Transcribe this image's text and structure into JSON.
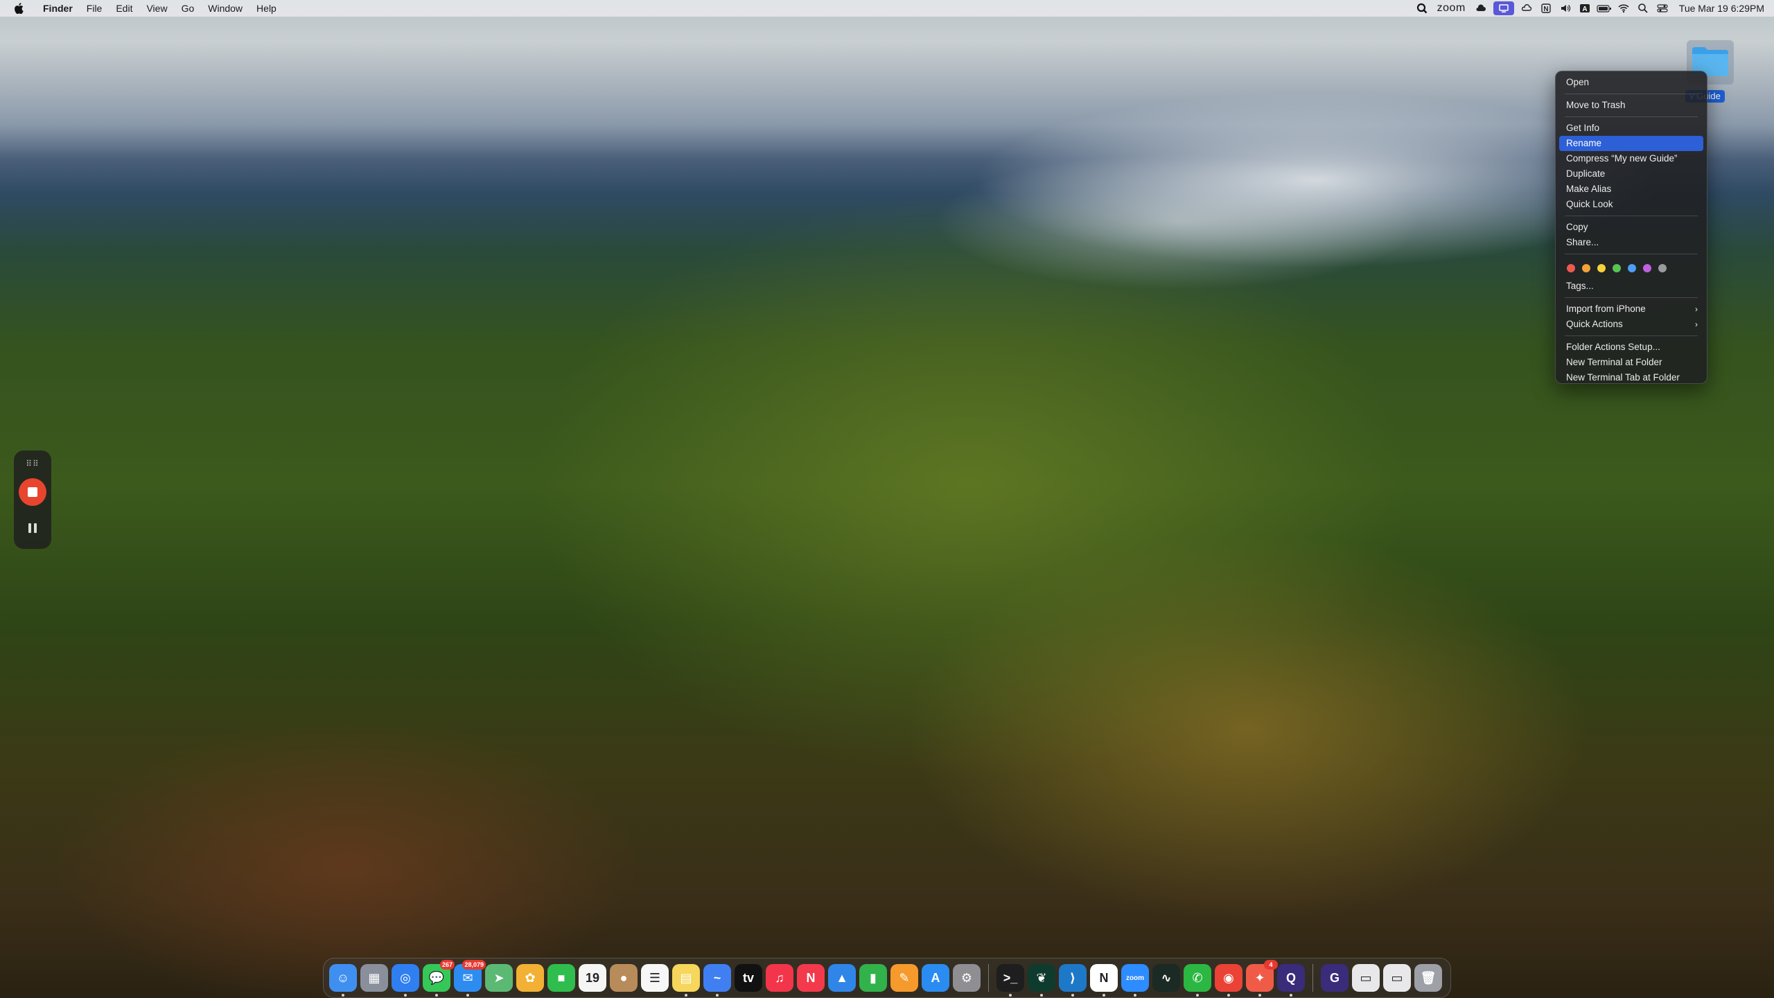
{
  "menubar": {
    "app_name": "Finder",
    "menus": [
      "File",
      "Edit",
      "View",
      "Go",
      "Window",
      "Help"
    ],
    "status_icons": [
      "search-app-icon",
      "zoom-text",
      "weather-icon",
      "screen-share-icon",
      "cloud-icon",
      "notion-icon",
      "volume-icon",
      "input-source-icon",
      "battery-icon",
      "wifi-icon",
      "spotlight-icon",
      "control-center-icon"
    ],
    "zoom_label": "zoom",
    "input_source_label": "A",
    "notion_label": "N",
    "clock": "Tue Mar 19  6:29PM"
  },
  "desktop": {
    "folder_label": "v Guide"
  },
  "context_menu": {
    "open": "Open",
    "move_to_trash": "Move to Trash",
    "get_info": "Get Info",
    "rename": "Rename",
    "compress": "Compress “My new Guide”",
    "duplicate": "Duplicate",
    "make_alias": "Make Alias",
    "quick_look": "Quick Look",
    "copy": "Copy",
    "share": "Share...",
    "tag_colors": [
      "#ec5a4f",
      "#f3a23a",
      "#f5d33a",
      "#58c453",
      "#4d9ef5",
      "#c060e0",
      "#9a9a9e"
    ],
    "tags": "Tags...",
    "import_from_iphone": "Import from iPhone",
    "quick_actions": "Quick Actions",
    "folder_actions_setup": "Folder Actions Setup...",
    "new_terminal_at_folder": "New Terminal at Folder",
    "new_terminal_tab_at_folder": "New Terminal Tab at Folder",
    "submenu_arrow": "›"
  },
  "recording_widget": {
    "grip": "⠿⠿"
  },
  "dock": {
    "apps": [
      {
        "name": "finder",
        "glyph": "☺",
        "color": "#3f8ff0",
        "running": true
      },
      {
        "name": "launchpad",
        "glyph": "▦",
        "color": "#8a8f9c",
        "running": false
      },
      {
        "name": "safari",
        "glyph": "◎",
        "color": "#2f7ff0",
        "running": true
      },
      {
        "name": "messages",
        "glyph": "💬",
        "color": "#36c759",
        "badge": "267",
        "running": true
      },
      {
        "name": "mail",
        "glyph": "✉",
        "color": "#2d8cf0",
        "badge": "28,079",
        "running": true
      },
      {
        "name": "maps",
        "glyph": "➤",
        "color": "#5bb974",
        "running": false
      },
      {
        "name": "photos",
        "glyph": "✿",
        "color": "#f2b134",
        "running": false
      },
      {
        "name": "facetime",
        "glyph": "■",
        "color": "#2fbe4d",
        "running": false
      },
      {
        "name": "calendar",
        "glyph": "19",
        "color": "#f5f5f5",
        "running": false
      },
      {
        "name": "contacts",
        "glyph": "●",
        "color": "#b88b5a",
        "running": false
      },
      {
        "name": "reminders",
        "glyph": "☰",
        "color": "#f7f7f7",
        "running": false
      },
      {
        "name": "notes",
        "glyph": "▤",
        "color": "#f6d65b",
        "running": true
      },
      {
        "name": "freeform",
        "glyph": "~",
        "color": "#3f7ff2",
        "running": true
      },
      {
        "name": "apple-tv",
        "glyph": "tv",
        "color": "#111111",
        "running": false
      },
      {
        "name": "music",
        "glyph": "♫",
        "color": "#f2354a",
        "running": false
      },
      {
        "name": "news",
        "glyph": "N",
        "color": "#f23a4c",
        "running": false
      },
      {
        "name": "keynote",
        "glyph": "▲",
        "color": "#2f86e8",
        "running": false
      },
      {
        "name": "numbers",
        "glyph": "▮",
        "color": "#32b24a",
        "running": false
      },
      {
        "name": "pages",
        "glyph": "✎",
        "color": "#f59a2b",
        "running": false
      },
      {
        "name": "app-store",
        "glyph": "A",
        "color": "#2a8cf0",
        "running": false
      },
      {
        "name": "system-settings",
        "glyph": "⚙",
        "color": "#8e8e93",
        "running": false
      },
      {
        "name": "terminal",
        "glyph": ">_",
        "color": "#1e1e1e",
        "running": true
      },
      {
        "name": "mongodb-compass",
        "glyph": "❦",
        "color": "#0f3b2e",
        "running": true
      },
      {
        "name": "vscode",
        "glyph": "⟩",
        "color": "#1e78c8",
        "running": true
      },
      {
        "name": "notion",
        "glyph": "N",
        "color": "#ffffff",
        "running": true
      },
      {
        "name": "zoom",
        "glyph": "zoom",
        "color": "#2d8cff",
        "running": true
      },
      {
        "name": "activity-monitor",
        "glyph": "∿",
        "color": "#1b2a24",
        "running": false
      },
      {
        "name": "whatsapp",
        "glyph": "✆",
        "color": "#2bb741",
        "running": true
      },
      {
        "name": "chrome",
        "glyph": "◉",
        "color": "#ea4335",
        "running": true
      },
      {
        "name": "figma-like",
        "glyph": "✦",
        "color": "#f05b48",
        "badge": "4",
        "running": true
      },
      {
        "name": "gitkraken-like",
        "glyph": "Q",
        "color": "#3a2c7a",
        "running": true
      }
    ],
    "stack": [
      {
        "name": "downloads-stack",
        "glyph": "G",
        "color": "#3a2c7a"
      },
      {
        "name": "document-stack-1",
        "glyph": "▭",
        "color": "#e8e8ea"
      },
      {
        "name": "document-stack-2",
        "glyph": "▭",
        "color": "#e8e8ea"
      },
      {
        "name": "trash",
        "glyph": "🗑",
        "color": "#9da0a6"
      }
    ]
  }
}
